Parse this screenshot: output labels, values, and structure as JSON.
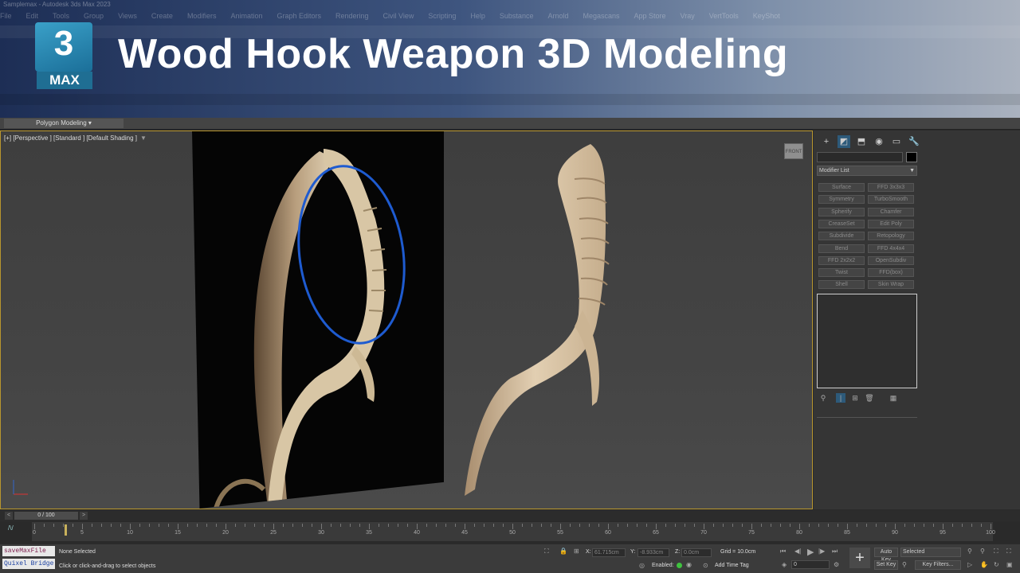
{
  "window": {
    "title": "Samplemax - Autodesk 3ds Max 2023",
    "menu": [
      "File",
      "Edit",
      "Tools",
      "Group",
      "Views",
      "Create",
      "Modifiers",
      "Animation",
      "Graph Editors",
      "Rendering",
      "Civil View",
      "Scripting",
      "Help",
      "Substance",
      "Arnold",
      "Megascans",
      "App Store",
      "Vray",
      "VertTools",
      "KeyShot"
    ]
  },
  "banner": {
    "logo_number": "3",
    "logo_text": "MAX",
    "title": "Wood Hook Weapon 3D Modeling"
  },
  "ribbon": {
    "tab_label": "Polygon Modeling ▾"
  },
  "viewport": {
    "label": "[+] [Perspective ] [Standard ] [Default Shading ]",
    "viewcube_label": "FRONT",
    "axis_x": "x",
    "axis_z": "z"
  },
  "command_panel": {
    "tabs": [
      "+",
      "◩",
      "⬒",
      "◉",
      "▭",
      "🔧"
    ],
    "modifier_list_label": "Modifier List",
    "modifier_buttons": [
      [
        "Surface",
        "FFD 3x3x3"
      ],
      [
        "Symmetry",
        "TurboSmooth"
      ],
      [
        "Spherify",
        "Chamfer"
      ],
      [
        "CreaseSet",
        "Edit Poly"
      ],
      [
        "Subdivide",
        "Retopology"
      ],
      [
        "Bend",
        "FFD 4x4x4"
      ],
      [
        "FFD 2x2x2",
        "OpenSubdiv"
      ],
      [
        "Twist",
        "FFD(box)"
      ],
      [
        "Shell",
        "Skin Wrap"
      ]
    ],
    "stack_tools": [
      "⚲",
      "|",
      "⊞",
      "🗑",
      "▦"
    ]
  },
  "timeline": {
    "frame_label": "0 / 100",
    "prev": "<",
    "next": ">",
    "ticks": [
      "0",
      "5",
      "10",
      "15",
      "20",
      "25",
      "30",
      "35",
      "40",
      "45",
      "50",
      "55",
      "60",
      "65",
      "70",
      "75",
      "80",
      "85",
      "90",
      "95",
      "100"
    ]
  },
  "status": {
    "maxscript_1": "saveMaxFile",
    "maxscript_2": "Quixel Bridge",
    "selection": "None Selected",
    "prompt": "Click or click-and-drag to select objects",
    "x_label": "X:",
    "x_value": "61.715cm",
    "y_label": "Y:",
    "y_value": "-8.933cm",
    "z_label": "Z:",
    "z_value": "0.0cm",
    "grid": "Grid = 10.0cm",
    "enabled_label": "Enabled:",
    "add_time_tag": "Add Time Tag",
    "auto_key": "Auto Key",
    "set_key": "Set Key",
    "selected_dropdown": "Selected",
    "key_filters": "Key Filters...",
    "frame_field": "0"
  }
}
